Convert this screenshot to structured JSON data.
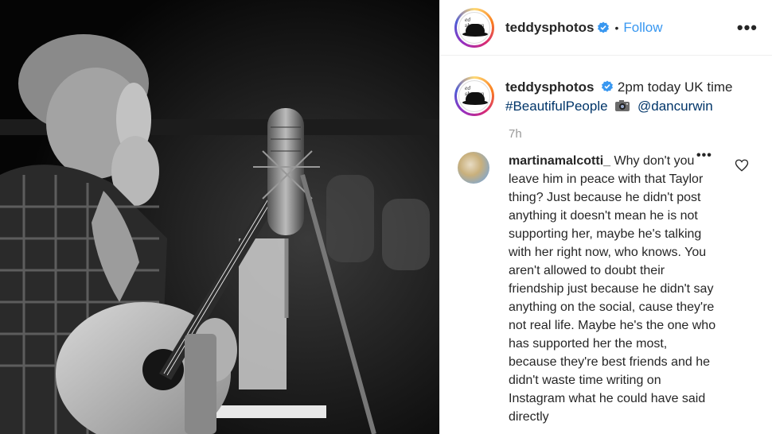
{
  "post": {
    "username": "teddysphotos",
    "follow_label": "Follow",
    "separator": "•",
    "more_label": "•••"
  },
  "caption": {
    "username": "teddysphotos",
    "text": "2pm today UK time",
    "hashtag": "#BeautifulPeople",
    "mention": "@dancurwin",
    "time": "7h"
  },
  "comment": {
    "username": "martinamalcotti_",
    "text": "Why don't you leave him in peace with that Taylor thing? Just because he didn't post anything it doesn't mean he is not supporting her, maybe he's talking with her right now, who knows. You aren't allowed to doubt their friendship just because he didn't say anything on the social, cause they're not real life. Maybe he's the one who has supported her the most, because they're best friends and he didn't waste time writing on Instagram what he could have said directly",
    "more_label": "•••"
  },
  "icons": {
    "verified": "verified-badge-icon",
    "more": "more-options-icon",
    "camera": "camera-emoji-icon",
    "heart": "heart-like-icon"
  },
  "colors": {
    "accent": "#3897f0",
    "hashtag": "#003569",
    "muted": "#999999"
  }
}
